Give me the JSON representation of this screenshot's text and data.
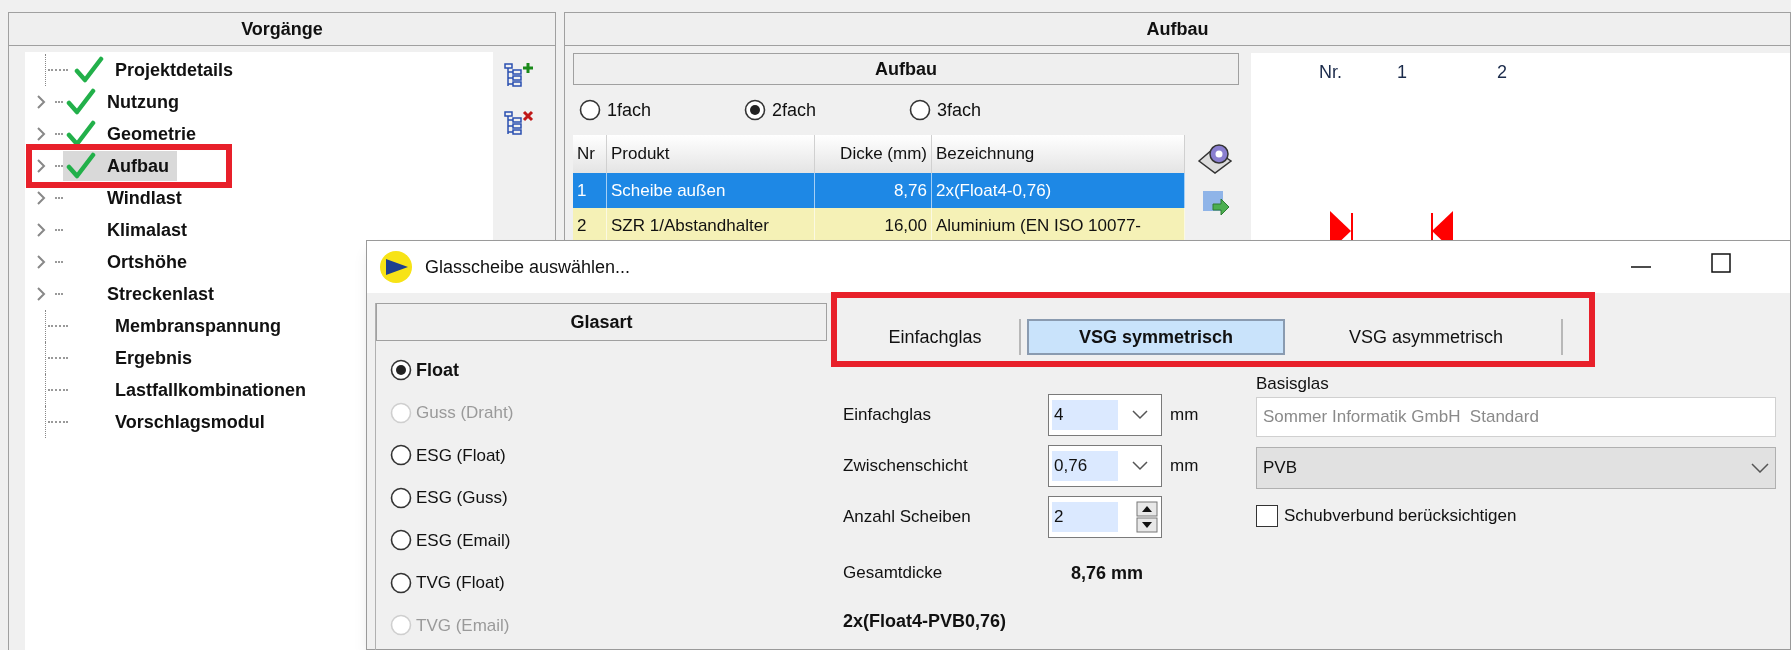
{
  "vorgaenge": {
    "title": "Vorgänge",
    "items": [
      {
        "label": "Projektdetails",
        "checked": true,
        "expandable": false,
        "selected": false
      },
      {
        "label": "Nutzung",
        "checked": true,
        "expandable": true,
        "selected": false
      },
      {
        "label": "Geometrie",
        "checked": true,
        "expandable": true,
        "selected": false
      },
      {
        "label": "Aufbau",
        "checked": true,
        "expandable": true,
        "selected": true
      },
      {
        "label": "Windlast",
        "checked": false,
        "expandable": true,
        "selected": false
      },
      {
        "label": "Klimalast",
        "checked": false,
        "expandable": true,
        "selected": false
      },
      {
        "label": "Ortshöhe",
        "checked": false,
        "expandable": true,
        "selected": false
      },
      {
        "label": "Streckenlast",
        "checked": false,
        "expandable": true,
        "selected": false
      },
      {
        "label": "Membranspannung",
        "checked": false,
        "expandable": false,
        "selected": false
      },
      {
        "label": "Ergebnis",
        "checked": false,
        "expandable": false,
        "selected": false
      },
      {
        "label": "Lastfallkombinationen",
        "checked": false,
        "expandable": false,
        "selected": false
      },
      {
        "label": "Vorschlagsmodul",
        "checked": false,
        "expandable": false,
        "selected": false
      }
    ]
  },
  "aufbau": {
    "title": "Aufbau",
    "group": {
      "title": "Aufbau",
      "options": [
        {
          "label": "1fach",
          "selected": false
        },
        {
          "label": "2fach",
          "selected": true
        },
        {
          "label": "3fach",
          "selected": false
        }
      ],
      "table": {
        "columns": [
          "Nr",
          "Produkt",
          "Dicke (mm)",
          "Bezeichnung"
        ],
        "rows": [
          {
            "selected": true,
            "cells": [
              "1",
              "Scheibe außen",
              "8,76",
              "2x(Float4-0,76)"
            ]
          },
          {
            "selected": false,
            "cells": [
              "2",
              "SZR 1/Abstandhalter",
              "16,00",
              "Aluminium (EN ISO 10077-"
            ]
          }
        ]
      }
    },
    "drawing": {
      "labels": [
        "Nr.",
        "1",
        "2"
      ]
    }
  },
  "dialog": {
    "title": "Glasscheibe auswählen...",
    "glasart": {
      "title": "Glasart",
      "options": [
        {
          "label": "Float",
          "selected": true,
          "disabled": false
        },
        {
          "label": "Guss (Draht)",
          "selected": false,
          "disabled": true
        },
        {
          "label": "ESG (Float)",
          "selected": false,
          "disabled": false
        },
        {
          "label": "ESG (Guss)",
          "selected": false,
          "disabled": false
        },
        {
          "label": "ESG (Email)",
          "selected": false,
          "disabled": false
        },
        {
          "label": "TVG (Float)",
          "selected": false,
          "disabled": false
        },
        {
          "label": "TVG (Email)",
          "selected": false,
          "disabled": true
        }
      ]
    },
    "tabs": [
      {
        "label": "Einfachglas",
        "selected": false
      },
      {
        "label": "VSG symmetrisch",
        "selected": true
      },
      {
        "label": "VSG asymmetrisch",
        "selected": false
      }
    ],
    "fields": [
      {
        "kind": "combo",
        "label": "Einfachglas",
        "value": "4",
        "unit": "mm"
      },
      {
        "kind": "combo",
        "label": "Zwischenschicht",
        "value": "0,76",
        "unit": "mm"
      },
      {
        "kind": "spin",
        "label": "Anzahl Scheiben",
        "value": "2"
      }
    ],
    "total": {
      "label": "Gesamtdicke",
      "value": "8,76 mm"
    },
    "formula": "2x(Float4-PVB0,76)",
    "basisglas": {
      "label": "Basisglas",
      "value": "Sommer Informatik GmbH  Standard",
      "disabled": true,
      "interlayer": "PVB"
    },
    "schubverbund": {
      "label": "Schubverbund berücksichtigen",
      "checked": false
    }
  }
}
